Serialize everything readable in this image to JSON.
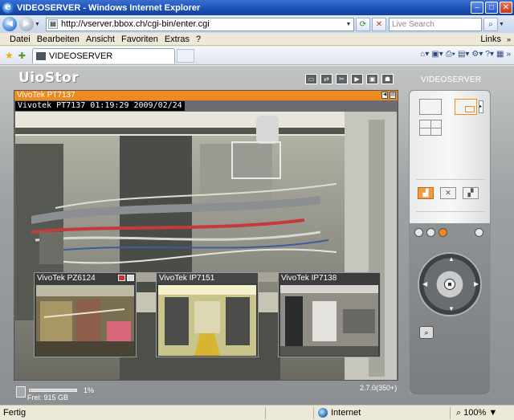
{
  "window": {
    "title": "VIDEOSERVER - Windows Internet Explorer"
  },
  "address": {
    "url": "http://vserver.bbox.ch/cgi-bin/enter.cgi",
    "search_placeholder": "Live Search"
  },
  "menu": {
    "items": [
      "Datei",
      "Bearbeiten",
      "Ansicht",
      "Favoriten",
      "Extras",
      "?"
    ],
    "links": "Links"
  },
  "tab": {
    "title": "VIDEOSERVER"
  },
  "app": {
    "brand": "UioStor",
    "server_name": "VIDEOSERVER",
    "main_camera": {
      "name": "VivoTek PT7137",
      "osd": "Vivotek PT7137 01:19:29 2009/02/24"
    },
    "thumbnails": [
      {
        "name": "VivoTek PZ6124"
      },
      {
        "name": "VivoTek IP7151"
      },
      {
        "name": "VivoTek IP7138"
      }
    ],
    "disk": {
      "usage_percent_text": "1%",
      "free_text": "Frei: 915 GB",
      "usage_fraction": 0.01
    },
    "version": "2.7.0(350+)"
  },
  "status": {
    "text": "Fertig",
    "zone": "Internet",
    "zoom": "100%"
  },
  "colors": {
    "accent": "#f08a1e",
    "titlebar": "#1a4fb8"
  }
}
